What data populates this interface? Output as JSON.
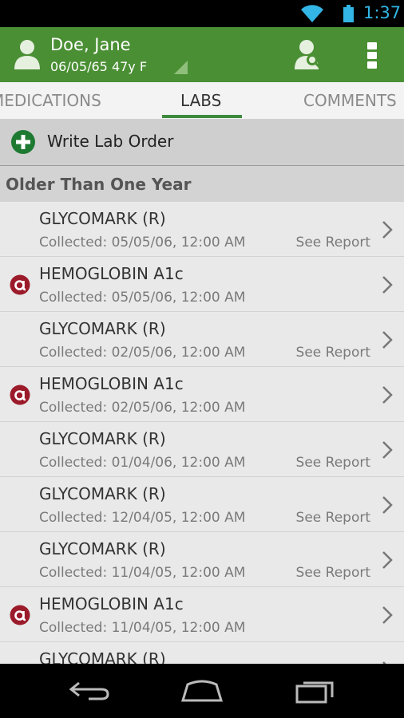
{
  "status_bar": {
    "time": "1:37",
    "icons": [
      "wifi-icon",
      "battery-icon"
    ],
    "accent_color": "#33b5e5"
  },
  "patient": {
    "name": "Doe, Jane",
    "info": "06/05/65 47y F",
    "header_color": "#4a8f34",
    "icons": [
      "person-icon",
      "patient-search-icon",
      "overflow-menu-icon"
    ]
  },
  "tabs": [
    {
      "label": "MEDICATIONS",
      "active": false
    },
    {
      "label": "LABS",
      "active": true
    },
    {
      "label": "COMMENTS",
      "active": false
    }
  ],
  "write_order": {
    "label": "Write Lab Order",
    "icon": "add-circle-icon"
  },
  "section": {
    "title": "Older Than One Year"
  },
  "labs": [
    {
      "name": "GLYCOMARK (R)",
      "collected": "Collected: 05/05/06, 12:00 AM",
      "report": "See Report",
      "abnormal": false
    },
    {
      "name": "HEMOGLOBIN A1c",
      "collected": "Collected: 05/05/06, 12:00 AM",
      "report": "",
      "abnormal": true
    },
    {
      "name": "GLYCOMARK (R)",
      "collected": "Collected: 02/05/06, 12:00 AM",
      "report": "See Report",
      "abnormal": false
    },
    {
      "name": "HEMOGLOBIN A1c",
      "collected": "Collected: 02/05/06, 12:00 AM",
      "report": "",
      "abnormal": true
    },
    {
      "name": "GLYCOMARK (R)",
      "collected": "Collected: 01/04/06, 12:00 AM",
      "report": "See Report",
      "abnormal": false
    },
    {
      "name": "GLYCOMARK (R)",
      "collected": "Collected: 12/04/05, 12:00 AM",
      "report": "See Report",
      "abnormal": false
    },
    {
      "name": "GLYCOMARK (R)",
      "collected": "Collected: 11/04/05, 12:00 AM",
      "report": "See Report",
      "abnormal": false
    },
    {
      "name": "HEMOGLOBIN A1c",
      "collected": "Collected: 11/04/05, 12:00 AM",
      "report": "",
      "abnormal": true
    },
    {
      "name": "GLYCOMARK (R)",
      "collected": "",
      "report": "",
      "abnormal": false
    }
  ],
  "nav": [
    "back-icon",
    "home-icon",
    "recent-apps-icon"
  ]
}
